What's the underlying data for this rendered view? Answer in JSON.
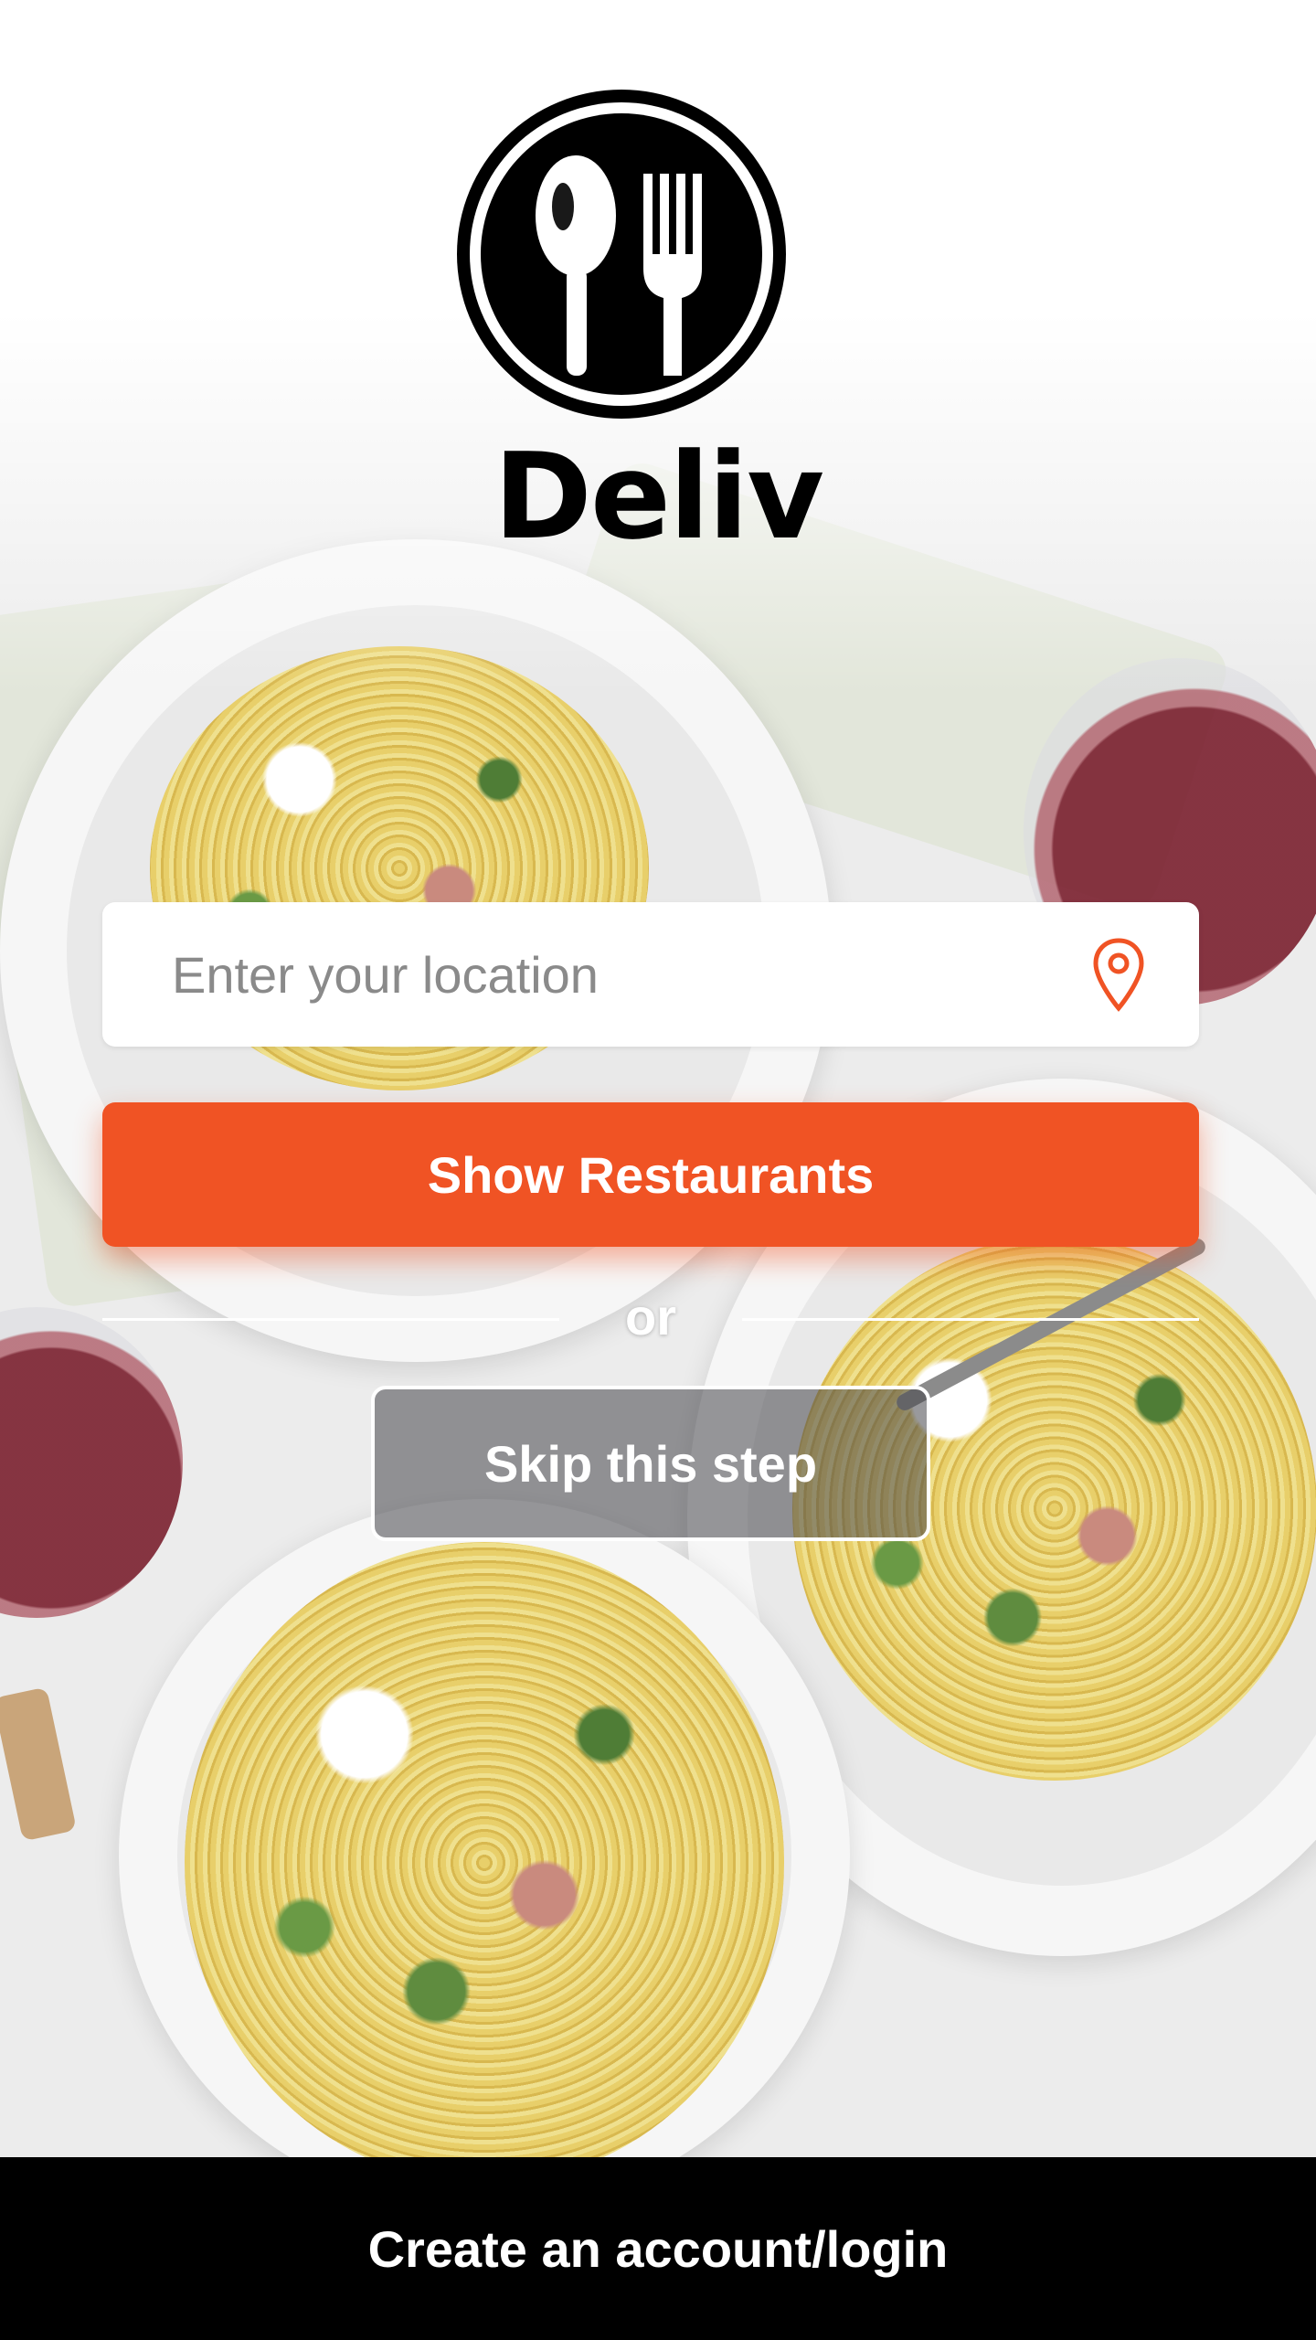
{
  "app": {
    "brand_name": "Deliv",
    "logo_icon": "spoon-fork-icon"
  },
  "location": {
    "placeholder": "Enter your location",
    "value": "",
    "icon": "location-pin-icon"
  },
  "actions": {
    "show_restaurants_label": "Show Restaurants",
    "divider_text": "or",
    "skip_label": "Skip this step"
  },
  "footer": {
    "account_label": "Create an account/login"
  },
  "colors": {
    "accent": "#f05324",
    "footer_bg": "#000000",
    "text_on_dark": "#ffffff"
  },
  "background_image": "food-photo"
}
